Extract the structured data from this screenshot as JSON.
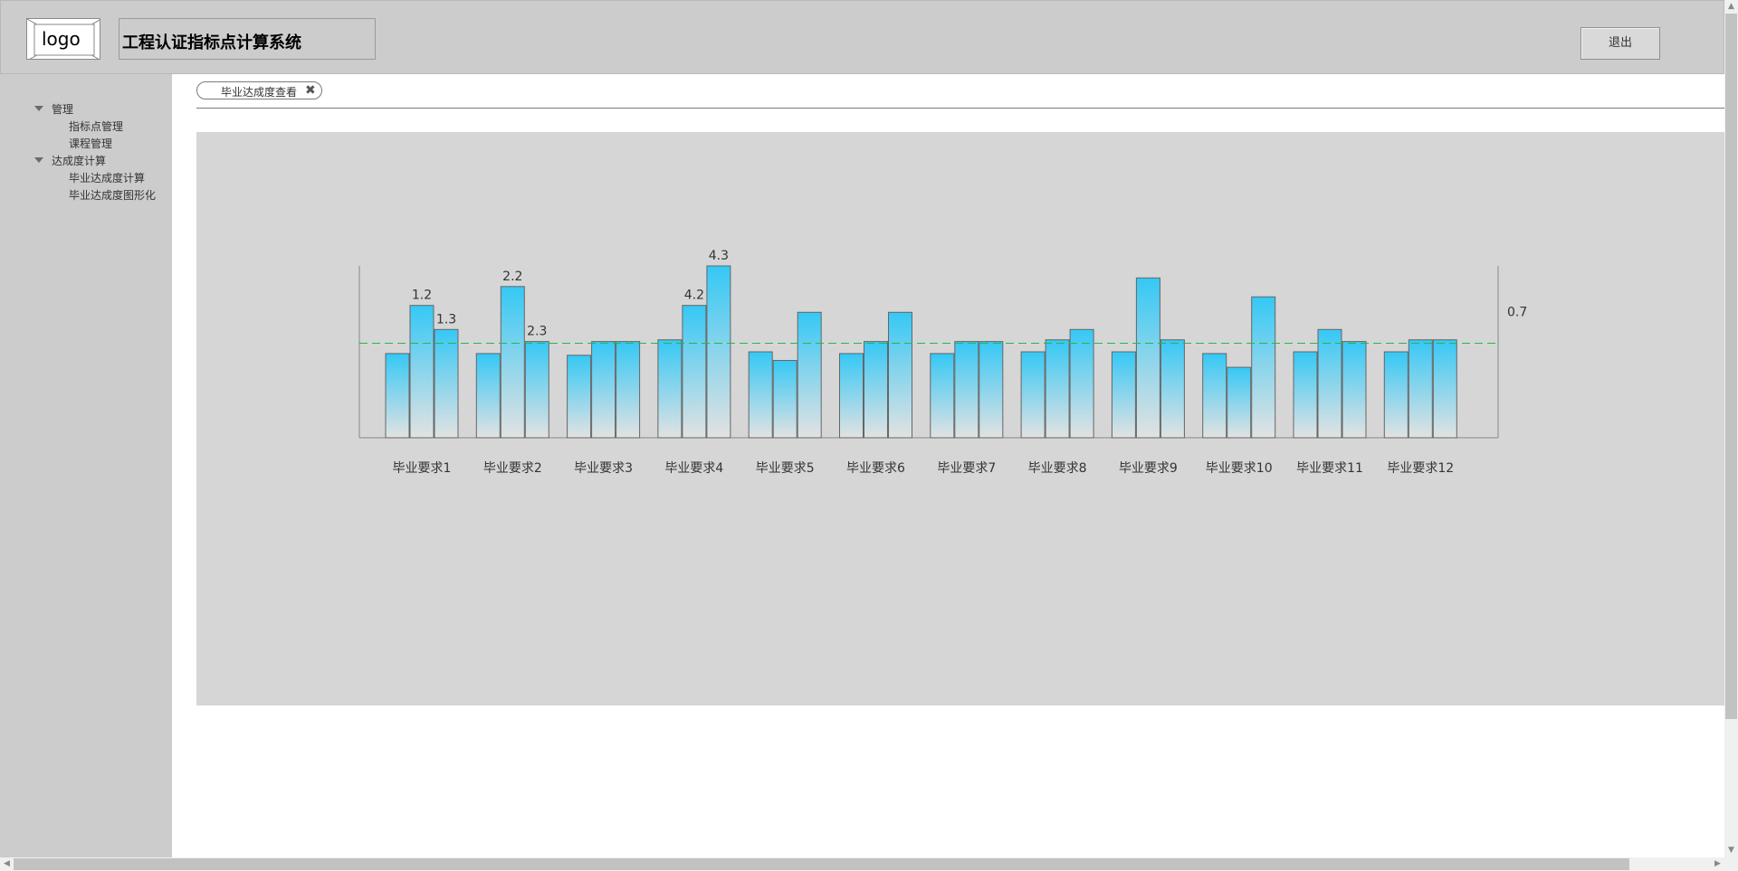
{
  "header": {
    "logo_text": "logo",
    "title": "工程认证指标点计算系统",
    "logout_label": "退出"
  },
  "sidebar": {
    "groups": [
      {
        "label": "管理",
        "items": [
          "指标点管理",
          "课程管理"
        ]
      },
      {
        "label": "达成度计算",
        "items": [
          "毕业达成度计算",
          "毕业达成度图形化"
        ]
      }
    ]
  },
  "tabs": [
    {
      "label": "毕业达成度查看",
      "close_icon": "close-icon"
    }
  ],
  "colors": {
    "bar_top": "#35c8f5",
    "bar_bottom": "#e2e2e2",
    "threshold_line": "#27b84a",
    "panel_bg": "#d6d6d6"
  },
  "chart_data": {
    "type": "bar",
    "categories": [
      "毕业要求1",
      "毕业要求2",
      "毕业要求3",
      "毕业要求4",
      "毕业要求5",
      "毕业要求6",
      "毕业要求7",
      "毕业要求8",
      "毕业要求9",
      "毕业要求10",
      "毕业要求11",
      "毕业要求12"
    ],
    "series": [
      {
        "values": [
          0.49,
          0.49,
          0.48,
          0.57,
          0.5,
          0.49,
          0.49,
          0.5,
          0.5,
          0.49,
          0.5,
          0.5
        ]
      },
      {
        "values": [
          0.77,
          0.88,
          0.56,
          0.77,
          0.45,
          0.56,
          0.56,
          0.57,
          0.93,
          0.41,
          0.63,
          0.57
        ]
      },
      {
        "values": [
          0.63,
          0.56,
          0.56,
          1.0,
          0.73,
          0.73,
          0.56,
          0.63,
          0.57,
          0.82,
          0.56,
          0.57
        ]
      }
    ],
    "data_labels": [
      {
        "category_index": 0,
        "series_index": 1,
        "text": "1.2"
      },
      {
        "category_index": 0,
        "series_index": 2,
        "text": "1.3"
      },
      {
        "category_index": 1,
        "series_index": 1,
        "text": "2.2"
      },
      {
        "category_index": 1,
        "series_index": 2,
        "text": "2.3"
      },
      {
        "category_index": 3,
        "series_index": 1,
        "text": "4.2"
      },
      {
        "category_index": 3,
        "series_index": 2,
        "text": "4.3"
      }
    ],
    "threshold": {
      "value": 0.55,
      "label": "0.7"
    },
    "ylim": [
      0,
      1.0
    ],
    "grid": false,
    "title": "",
    "xlabel": "",
    "ylabel": ""
  }
}
